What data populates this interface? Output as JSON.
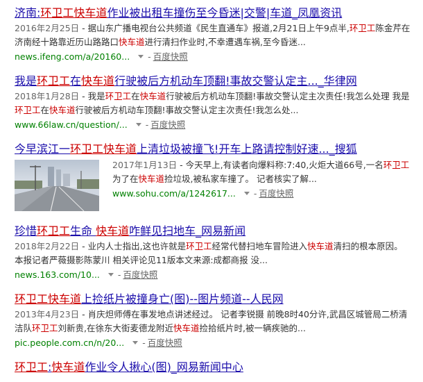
{
  "results": [
    {
      "title": [
        {
          "t": "济南:"
        },
        {
          "t": "环卫工",
          "hl": true
        },
        {
          "t": "快车道",
          "hl": true
        },
        {
          "t": "作业被出租车撞伤至今昏迷|交警|车道_凤凰资讯"
        }
      ],
      "date": "2016年2月25日",
      "desc": [
        {
          "t": " - 据山东广播电视台公共频道《民生直通车》报道,2月21日上午9点半,"
        },
        {
          "t": "环卫工",
          "hl": true
        },
        {
          "t": "陈金芹在济南经十路靠近历山路路口"
        },
        {
          "t": "快车道",
          "hl": true
        },
        {
          "t": "进行清扫作业时,不幸遭遇车祸,至今昏迷..."
        }
      ],
      "url": "news.ifeng.com/a/20160...",
      "cache": "百度快照"
    },
    {
      "title": [
        {
          "t": "我是"
        },
        {
          "t": "环卫工",
          "hl": true
        },
        {
          "t": "在"
        },
        {
          "t": "快车道",
          "hl": true
        },
        {
          "t": "行驶被后方机动车顶翻!事故交警认定主..._华律网"
        }
      ],
      "date": "2018年1月28日",
      "desc": [
        {
          "t": " - 我是"
        },
        {
          "t": "环卫工",
          "hl": true
        },
        {
          "t": "在"
        },
        {
          "t": "快车道",
          "hl": true
        },
        {
          "t": "行驶被后方机动车顶翻!事故交警认定主次责任!我怎么处理 我是"
        },
        {
          "t": "环卫工",
          "hl": true
        },
        {
          "t": "在"
        },
        {
          "t": "快车道",
          "hl": true
        },
        {
          "t": "行驶被后方机动车顶翻!事故交警认定主次责任!我怎么处..."
        }
      ],
      "url": "www.66law.cn/question/...",
      "cache": "百度快照"
    },
    {
      "title": [
        {
          "t": "今早滨江一"
        },
        {
          "t": "环卫工",
          "hl": true
        },
        {
          "t": "快车道",
          "hl": true
        },
        {
          "t": "上清垃圾被撞飞!开车上路请控制好速..._搜狐"
        }
      ],
      "date": "2017年1月13日",
      "desc": [
        {
          "t": " - 今天早上,有读者向爆料称:7:40,火炬大道66号,一名"
        },
        {
          "t": "环卫工",
          "hl": true
        },
        {
          "t": "为了在"
        },
        {
          "t": "快车道",
          "hl": true
        },
        {
          "t": "捡垃圾,被私家车撞了。 记者核实了解..."
        }
      ],
      "url": "www.sohu.com/a/1242617...",
      "cache": "百度快照"
    },
    {
      "title": [
        {
          "t": "珍惜"
        },
        {
          "t": "环卫工",
          "hl": true
        },
        {
          "t": "生命 "
        },
        {
          "t": "快车道",
          "hl": true
        },
        {
          "t": "咋鲜见扫地车_网易新闻"
        }
      ],
      "date": "2018年2月22日",
      "desc": [
        {
          "t": " - 业内人士指出,这也许就是"
        },
        {
          "t": "环卫工",
          "hl": true
        },
        {
          "t": "经常代替扫地车冒险进入"
        },
        {
          "t": "快车道",
          "hl": true
        },
        {
          "t": "清扫的根本原因。本报记者严薇摄影陈蒙川 相关评论见11版本文来源:成都商报 没..."
        }
      ],
      "url": "news.163.com/10...",
      "cache": "百度快照"
    },
    {
      "title": [
        {
          "t": "环卫工",
          "hl": true
        },
        {
          "t": "快车道",
          "hl": true
        },
        {
          "t": "上捡纸片被撞身亡(图)--图片频道--人民网"
        }
      ],
      "date": "2013年4月23日",
      "desc": [
        {
          "t": " - 肖庆炟师傅在事发地点讲述经过。 记者李锐摄 前晚8时40分许,武昌区城管局二桥清洁队"
        },
        {
          "t": "环卫工",
          "hl": true
        },
        {
          "t": "刘新贵,在徐东大街麦德龙附近"
        },
        {
          "t": "快车道",
          "hl": true
        },
        {
          "t": "捡拾纸片时,被一辆疾驰的..."
        }
      ],
      "url": "pic.people.com.cn/n/20...",
      "cache": "百度快照"
    },
    {
      "title": [
        {
          "t": "环卫工",
          "hl": true
        },
        {
          "t": ":"
        },
        {
          "t": "快车道",
          "hl": true
        },
        {
          "t": "作业令人揪心(图)_网易新闻中心"
        }
      ]
    }
  ]
}
